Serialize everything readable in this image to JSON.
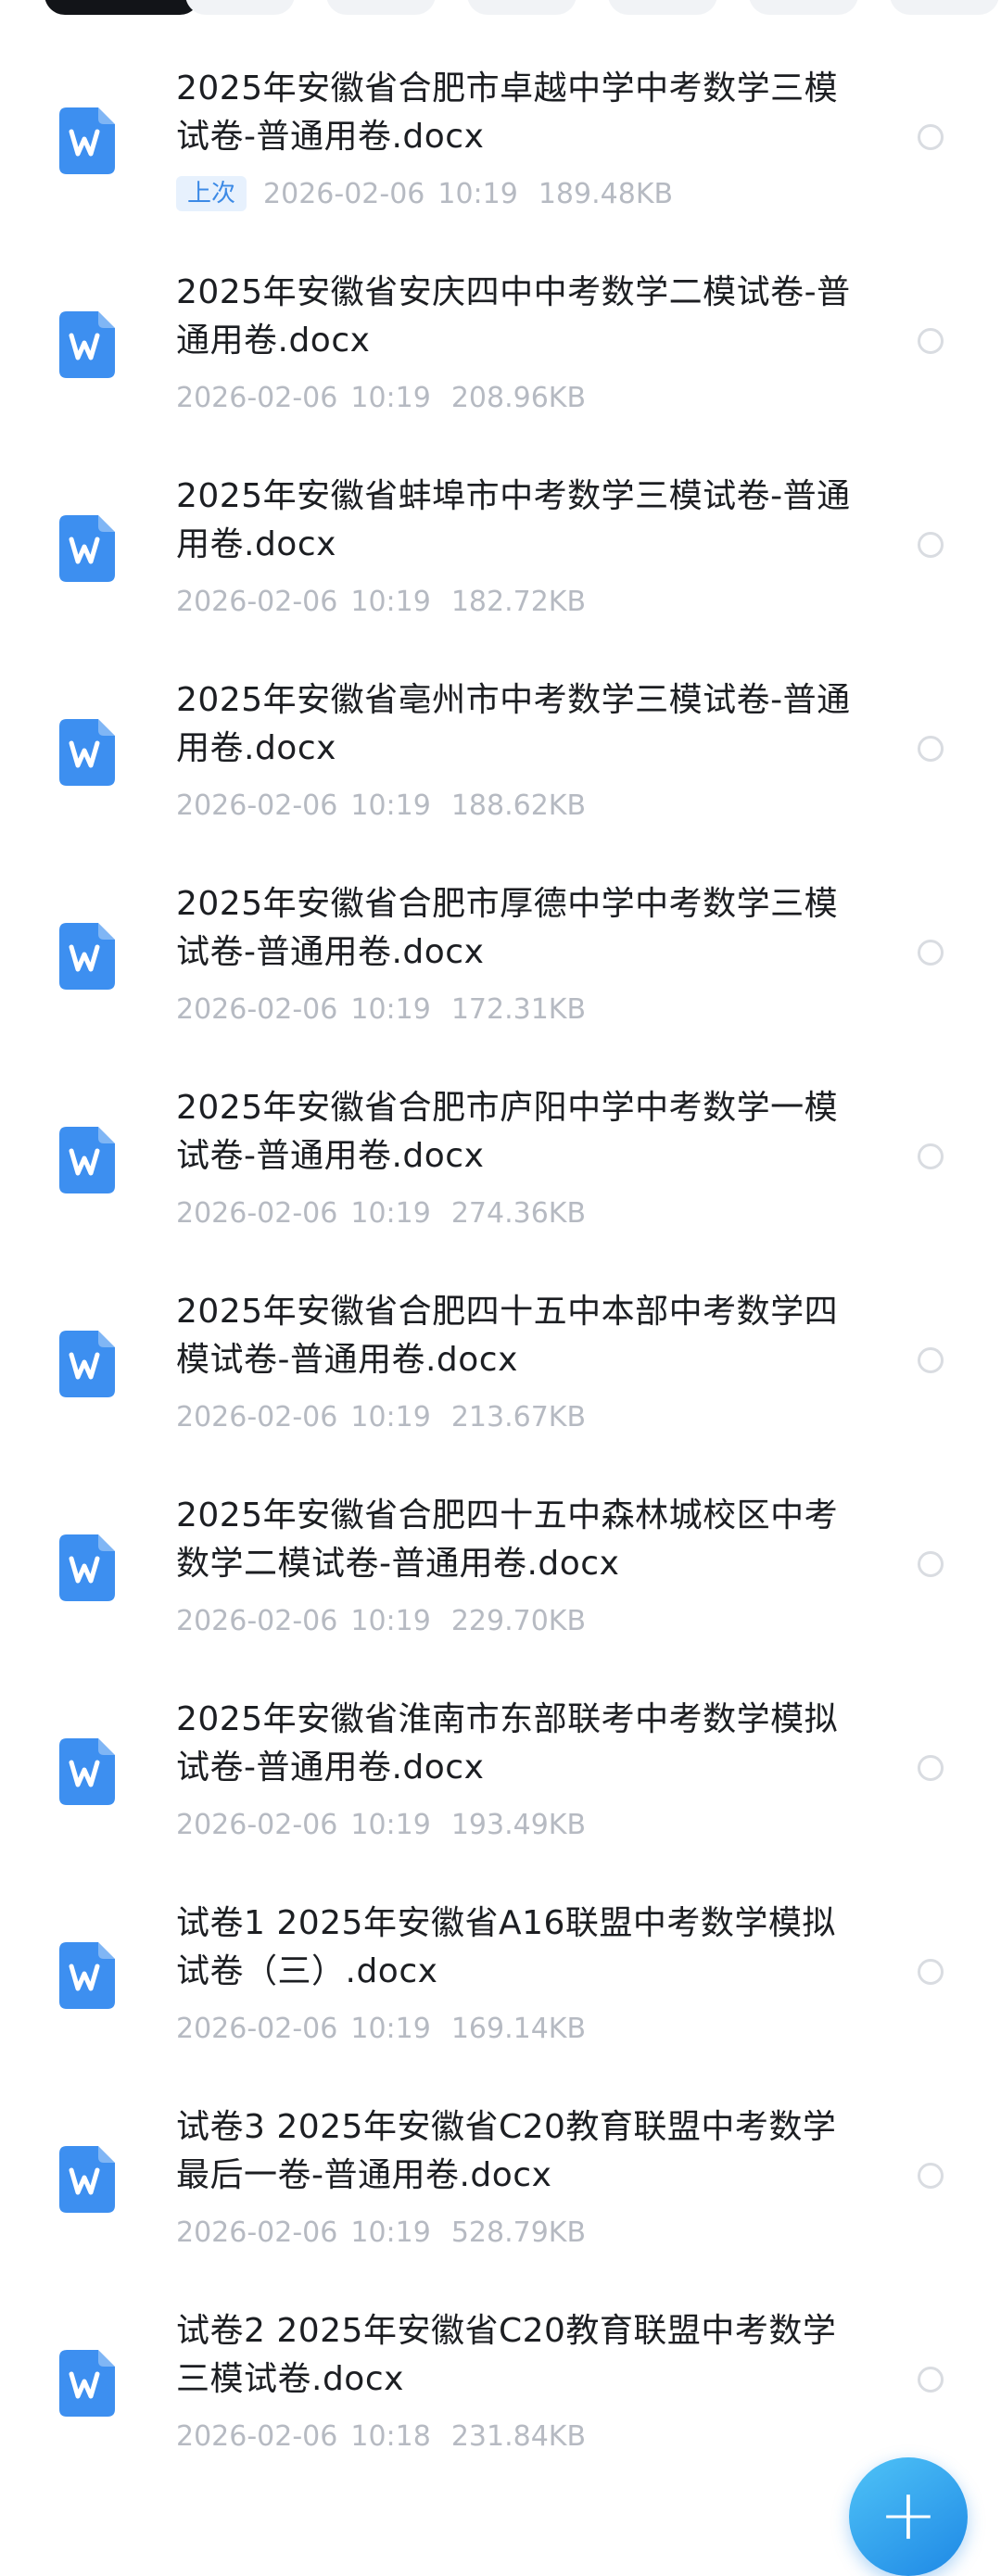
{
  "filter_chips": [
    {
      "label": "",
      "active": true
    },
    {
      "label": "",
      "active": false
    },
    {
      "label": "",
      "active": false
    },
    {
      "label": "",
      "active": false
    },
    {
      "label": "",
      "active": false
    },
    {
      "label": "",
      "active": false
    },
    {
      "label": "",
      "active": false
    }
  ],
  "colors": {
    "accent": "#3c8ae6",
    "word_icon": "#3d8ff0",
    "meta_text": "#b6bac2",
    "title_text": "#1c1e22",
    "fab_gradient_start": "#4fc3f7",
    "fab_gradient_end": "#1e88e5"
  },
  "files": [
    {
      "name": "2025年安徽省合肥市卓越中学中考数学三模试卷-普通用卷.docx",
      "badge": "上次",
      "date": "2026-02-06",
      "time": "10:19",
      "size": "189.48KB",
      "icon": "word-doc-icon"
    },
    {
      "name": "2025年安徽省安庆四中中考数学二模试卷-普通用卷.docx",
      "badge": "",
      "date": "2026-02-06",
      "time": "10:19",
      "size": "208.96KB",
      "icon": "word-doc-icon"
    },
    {
      "name": "2025年安徽省蚌埠市中考数学三模试卷-普通用卷.docx",
      "badge": "",
      "date": "2026-02-06",
      "time": "10:19",
      "size": "182.72KB",
      "icon": "word-doc-icon"
    },
    {
      "name": "2025年安徽省亳州市中考数学三模试卷-普通用卷.docx",
      "badge": "",
      "date": "2026-02-06",
      "time": "10:19",
      "size": "188.62KB",
      "icon": "word-doc-icon"
    },
    {
      "name": "2025年安徽省合肥市厚德中学中考数学三模试卷-普通用卷.docx",
      "badge": "",
      "date": "2026-02-06",
      "time": "10:19",
      "size": "172.31KB",
      "icon": "word-doc-icon"
    },
    {
      "name": "2025年安徽省合肥市庐阳中学中考数学一模试卷-普通用卷.docx",
      "badge": "",
      "date": "2026-02-06",
      "time": "10:19",
      "size": "274.36KB",
      "icon": "word-doc-icon"
    },
    {
      "name": "2025年安徽省合肥四十五中本部中考数学四模试卷-普通用卷.docx",
      "badge": "",
      "date": "2026-02-06",
      "time": "10:19",
      "size": "213.67KB",
      "icon": "word-doc-icon"
    },
    {
      "name": "2025年安徽省合肥四十五中森林城校区中考数学二模试卷-普通用卷.docx",
      "badge": "",
      "date": "2026-02-06",
      "time": "10:19",
      "size": "229.70KB",
      "icon": "word-doc-icon"
    },
    {
      "name": "2025年安徽省淮南市东部联考中考数学模拟试卷-普通用卷.docx",
      "badge": "",
      "date": "2026-02-06",
      "time": "10:19",
      "size": "193.49KB",
      "icon": "word-doc-icon"
    },
    {
      "name": "试卷1  2025年安徽省A16联盟中考数学模拟试卷（三）.docx",
      "badge": "",
      "date": "2026-02-06",
      "time": "10:19",
      "size": "169.14KB",
      "icon": "word-doc-icon"
    },
    {
      "name": "试卷3  2025年安徽省C20教育联盟中考数学最后一卷-普通用卷.docx",
      "badge": "",
      "date": "2026-02-06",
      "time": "10:19",
      "size": "528.79KB",
      "icon": "word-doc-icon"
    },
    {
      "name": "试卷2  2025年安徽省C20教育联盟中考数学三模试卷.docx",
      "badge": "",
      "date": "2026-02-06",
      "time": "10:18",
      "size": "231.84KB",
      "icon": "word-doc-icon"
    }
  ],
  "fab": {
    "label": "+",
    "icon": "plus-icon"
  }
}
